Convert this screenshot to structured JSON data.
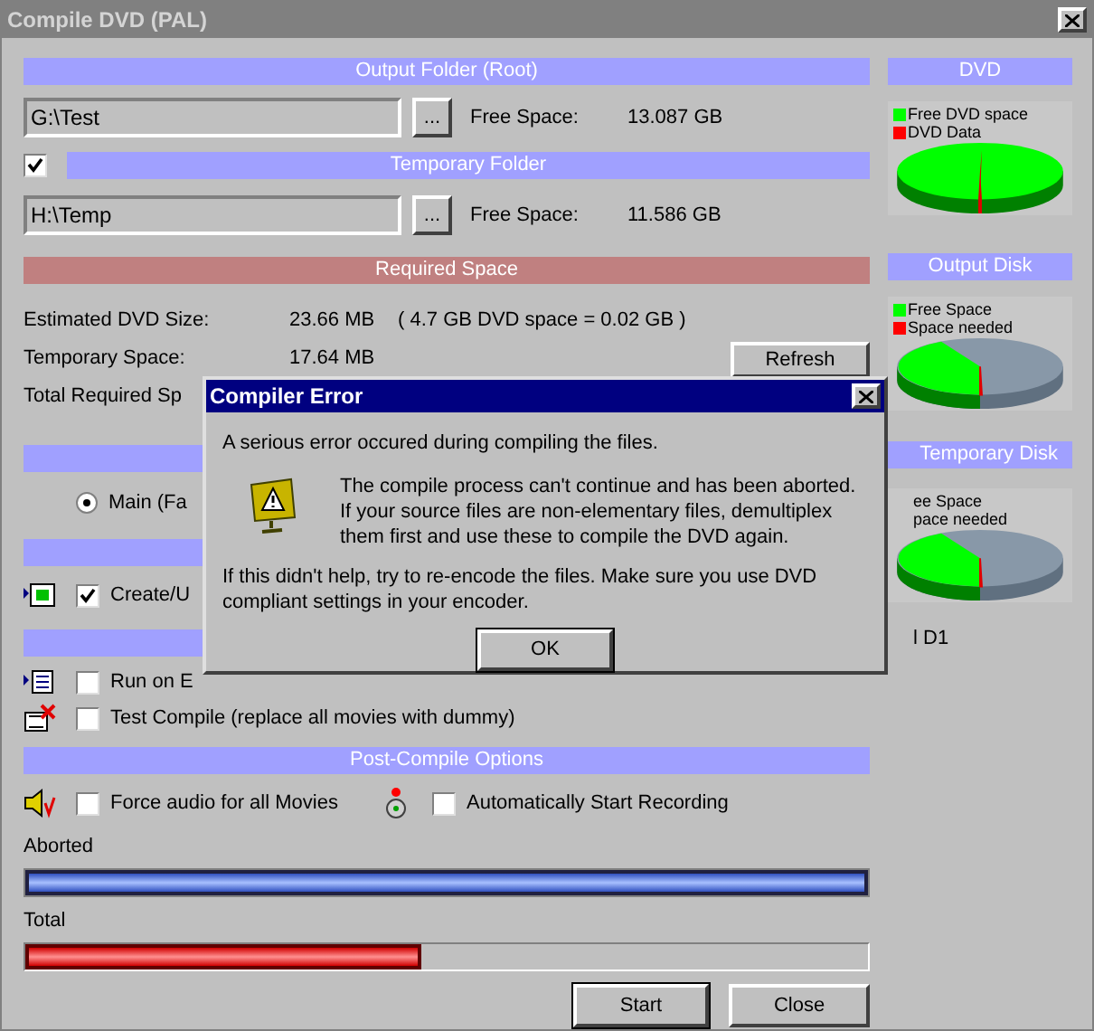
{
  "window": {
    "title": "Compile DVD (PAL)"
  },
  "output_folder": {
    "header": "Output Folder (Root)",
    "path": "G:\\Test",
    "browse": "...",
    "free_label": "Free Space:",
    "free_value": "13.087 GB"
  },
  "temp_folder": {
    "checked": true,
    "header": "Temporary Folder",
    "path": "H:\\Temp",
    "browse": "...",
    "free_label": "Free Space:",
    "free_value": "11.586 GB"
  },
  "required": {
    "header": "Required Space",
    "refresh": "Refresh",
    "rows": [
      {
        "label": "Estimated DVD Size:",
        "value": "23.66 MB",
        "note": "( 4.7 GB DVD space = 0.02 GB )"
      },
      {
        "label": "Temporary Space:",
        "value": "17.64 MB"
      },
      {
        "label": "Total Required Sp"
      }
    ]
  },
  "mode": {
    "label": "Main (Fa",
    "selected": true
  },
  "create": {
    "label": "Create/U",
    "checked": true
  },
  "run_on": {
    "label": "Run on E",
    "checked": false
  },
  "test_compile": {
    "label": "Test Compile (replace all movies with dummy)",
    "checked": false
  },
  "post_compile": {
    "header": "Post-Compile Options",
    "options": [
      {
        "kind": "audio",
        "label": "Force audio for all Movies",
        "checked": false
      },
      {
        "kind": "record",
        "label": "Automatically Start Recording",
        "checked": false
      }
    ]
  },
  "progress": [
    {
      "kind": "current",
      "label": "Aborted",
      "level": 1
    },
    {
      "kind": "total",
      "label": "Total",
      "level": 0.47
    }
  ],
  "buttons": [
    "Start",
    "Close"
  ],
  "side_panels": [
    {
      "kind": "dvd",
      "header": "DVD",
      "legend": [
        {
          "label": "Free DVD space",
          "color": "#00ff00"
        },
        {
          "label": "DVD Data",
          "color": "#ff0000"
        }
      ]
    },
    {
      "kind": "disk",
      "header": "Output Disk",
      "legend": [
        {
          "label": "Free Space",
          "color": "#00ff00"
        },
        {
          "label": "Space needed",
          "color": "#ff0000"
        }
      ]
    },
    {
      "kind": "disk",
      "header": "Temporary Disk",
      "legend": [
        {
          "label": "ee Space"
        },
        {
          "label": "pace needed"
        }
      ]
    }
  ],
  "side_note": "l D1",
  "dialog": {
    "title": "Compiler Error",
    "intro": "A serious error occured during compiling the files.",
    "message": "The compile process can't continue and has been aborted. If your source files are non-elementary files, demultiplex them first and use these to compile the DVD again.",
    "hint": "If this didn't help, try to re-encode the files. Make sure you use DVD compliant settings in your encoder.",
    "button": "OK"
  }
}
